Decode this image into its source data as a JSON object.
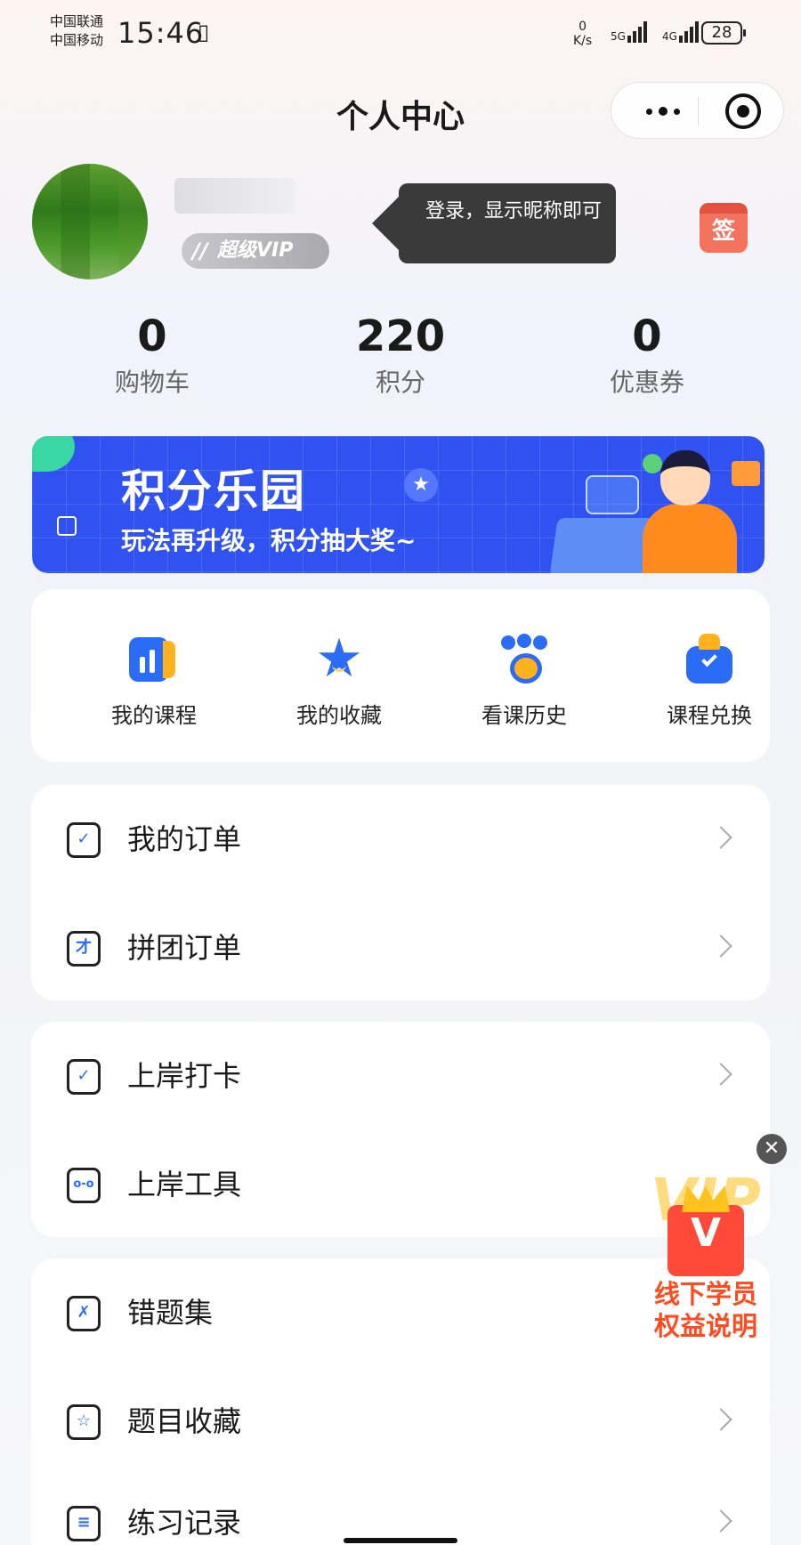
{
  "status_bar": {
    "carrier_1": "中国联通",
    "carrier_2": "中国移动",
    "time": "15:46",
    "net_speed_value": "0",
    "net_speed_unit": "K/s",
    "sim1_type": "5G",
    "sim2_type": "4G",
    "battery": "28"
  },
  "nav": {
    "title": "个人中心"
  },
  "profile": {
    "vip_label": "超级VIP",
    "tooltip": "登录，显示昵称即可",
    "signin_label": "签"
  },
  "stats": [
    {
      "value": "0",
      "label": "购物车"
    },
    {
      "value": "220",
      "label": "积分"
    },
    {
      "value": "0",
      "label": "优惠券"
    }
  ],
  "banner": {
    "title": "积分乐园",
    "subtitle": "玩法再升级，积分抽大奖~"
  },
  "quick_entries": [
    {
      "label": "我的课程",
      "icon": "course-chart-icon"
    },
    {
      "label": "我的收藏",
      "icon": "star-icon"
    },
    {
      "label": "看课历史",
      "icon": "paw-history-icon"
    },
    {
      "label": "课程兑换",
      "icon": "gift-bag-icon"
    }
  ],
  "orders_group": [
    {
      "label": "我的订单",
      "icon": "order-clipboard-icon",
      "glyph": "✓"
    },
    {
      "label": "拼团订单",
      "icon": "group-order-icon",
      "glyph": "才"
    }
  ],
  "tools_group": [
    {
      "label": "上岸打卡",
      "icon": "calendar-check-icon",
      "glyph": "✓"
    },
    {
      "label": "上岸工具",
      "icon": "toolbox-icon",
      "glyph": "o-o"
    }
  ],
  "practice_group": [
    {
      "label": "错题集",
      "icon": "wrong-questions-icon",
      "glyph": "✗"
    },
    {
      "label": "题目收藏",
      "icon": "question-favorite-icon",
      "glyph": "☆"
    },
    {
      "label": "练习记录",
      "icon": "practice-record-icon",
      "glyph": "≡"
    }
  ],
  "floating_vip": {
    "badge": "VIP",
    "line_1": "线下学员",
    "line_2": "权益说明"
  },
  "colors": {
    "accent_blue": "#2b6cf6",
    "accent_orange": "#ffb11e",
    "banner_blue": "#2f52f0"
  }
}
